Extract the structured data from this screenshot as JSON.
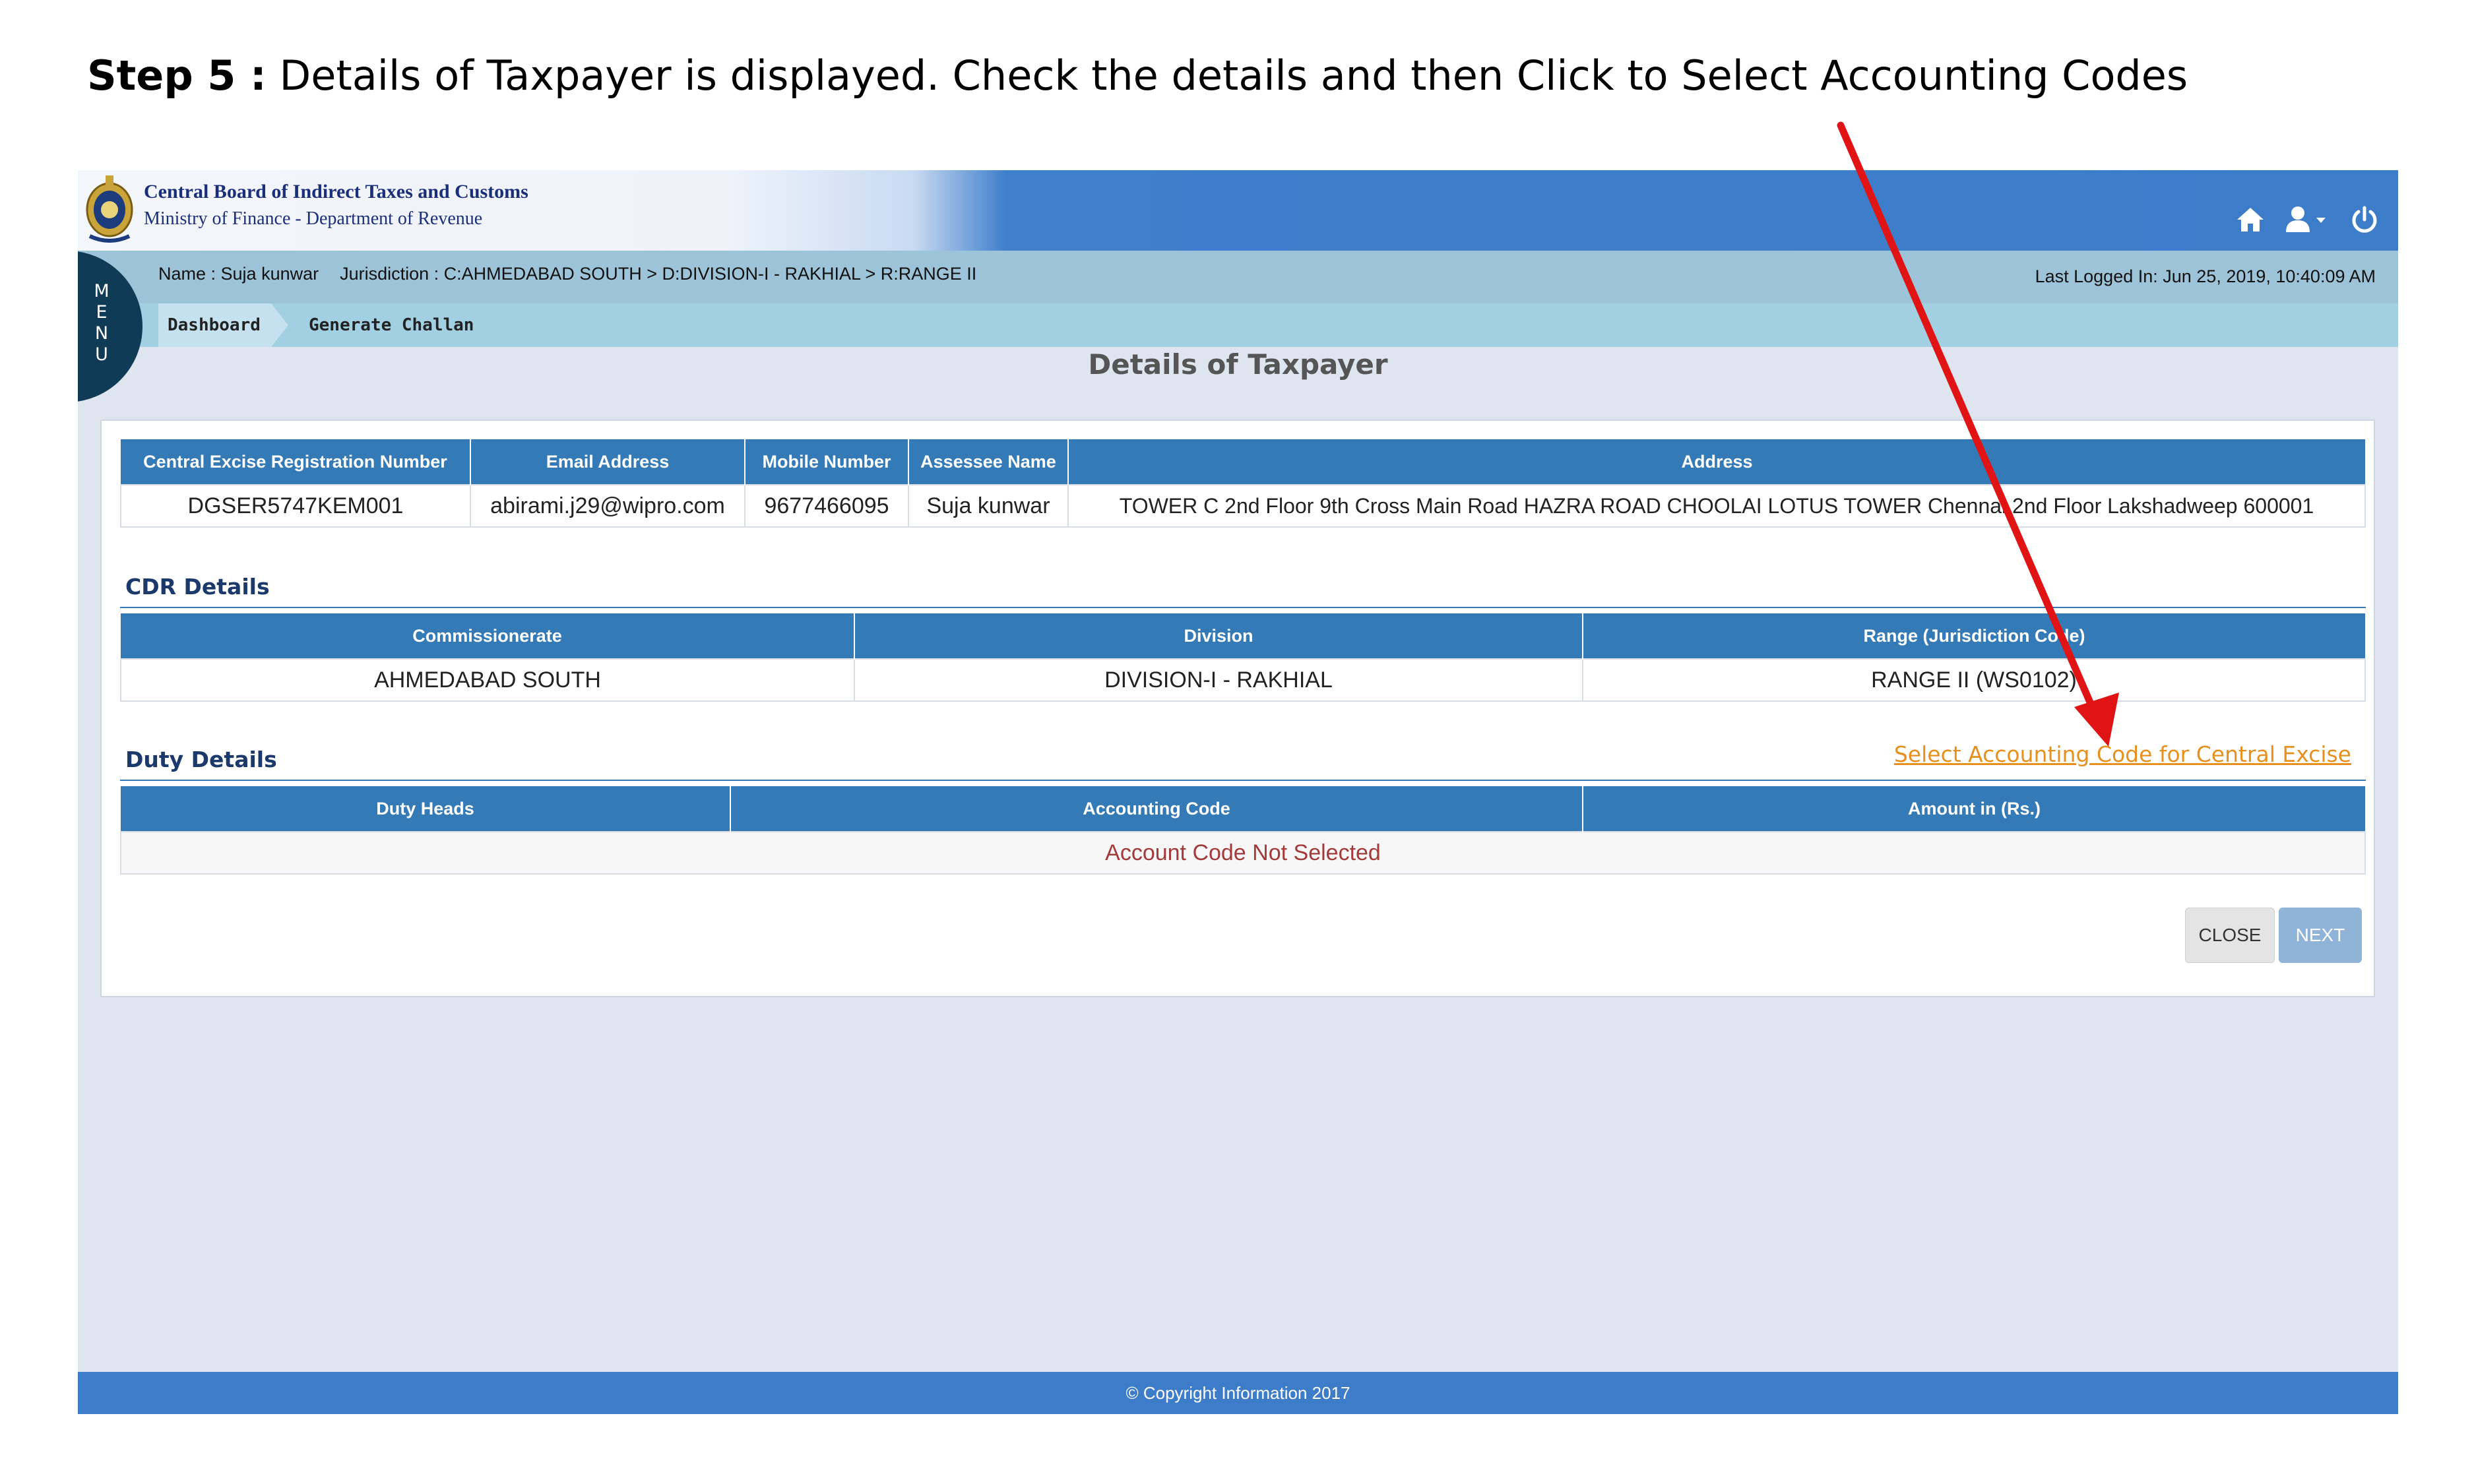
{
  "step": {
    "label": "Step 5 :",
    "text": "Details of Taxpayer is displayed. Check the details and then Click to Select Accounting Codes"
  },
  "header": {
    "org_name": "Central Board of Indirect Taxes and Customs",
    "org_sub": "Ministry of Finance - Department of Revenue",
    "icons": [
      "home-icon",
      "user-icon",
      "power-icon"
    ]
  },
  "infobar": {
    "name": "Name : Suja kunwar",
    "jurisdiction": "Jurisdiction : C:AHMEDABAD SOUTH > D:DIVISION-I - RAKHIAL > R:RANGE II",
    "last_login": "Last Logged In: Jun 25, 2019, 10:40:09 AM"
  },
  "breadcrumb": {
    "items": [
      "Dashboard",
      "Generate Challan"
    ]
  },
  "menu": {
    "label": "M E N U"
  },
  "page_title": "Details of Taxpayer",
  "taxpayer": {
    "headers": [
      "Central Excise Registration Number",
      "Email Address",
      "Mobile Number",
      "Assessee Name",
      "Address"
    ],
    "row": [
      "DGSER5747KEM001",
      "abirami.j29@wipro.com",
      "9677466095",
      "Suja kunwar",
      "TOWER C 2nd Floor 9th Cross Main Road HAZRA ROAD CHOOLAI LOTUS TOWER Chennai 2nd Floor Lakshadweep 600001"
    ]
  },
  "cdr": {
    "title": "CDR Details",
    "headers": [
      "Commissionerate",
      "Division",
      "Range (Jurisdiction Code)"
    ],
    "row": [
      "AHMEDABAD SOUTH",
      "DIVISION-I - RAKHIAL",
      "RANGE II (WS0102)"
    ]
  },
  "duty": {
    "title": "Duty Details",
    "link": "Select Accounting Code for Central Excise",
    "headers": [
      "Duty Heads",
      "Accounting Code",
      "Amount in (Rs.)"
    ],
    "empty_message": "Account Code Not Selected"
  },
  "buttons": {
    "close": "CLOSE",
    "next": "NEXT"
  },
  "footer": "© Copyright Information 2017",
  "colors": {
    "header_blue": "#3c7cc9",
    "table_header": "#337ab7",
    "link_orange": "#e8901e",
    "annotation_red": "#e01414",
    "menu_navy": "#0f3b57"
  }
}
